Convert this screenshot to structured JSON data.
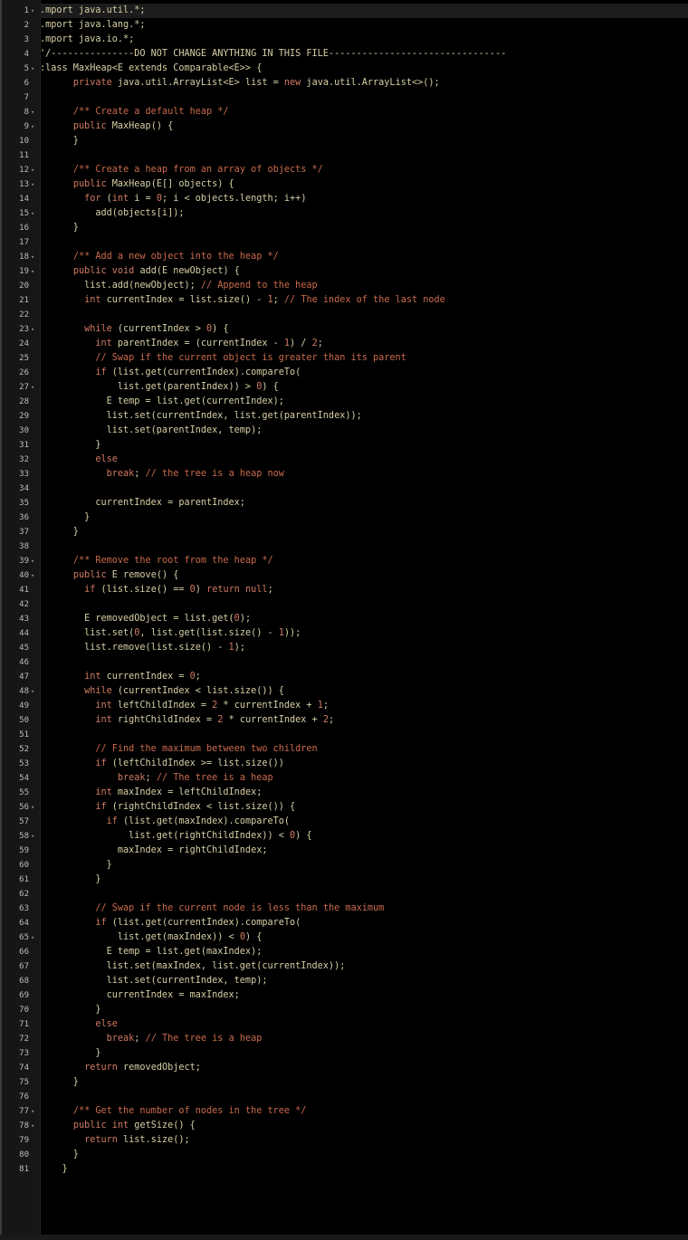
{
  "editor": {
    "language": "java",
    "colors": {
      "background": "#000000",
      "gutter": "#161616",
      "line_number": "#bdbdbd",
      "keyword": "#d07a62",
      "comment": "#c96a4c",
      "text": "#d6cfa6"
    },
    "fold_icon": "chevron-down-icon",
    "active_line": 1,
    "lines": [
      {
        "n": "1",
        "fold": true,
        "text": ".mport java.util.*;"
      },
      {
        "n": "2",
        "fold": false,
        "text": ".mport java.lang.*;"
      },
      {
        "n": "3",
        "fold": false,
        "text": ".mport java.io.*;"
      },
      {
        "n": "4",
        "fold": false,
        "text": "'/---------------DO NOT CHANGE ANYTHING IN THIS FILE--------------------------------"
      },
      {
        "n": "5",
        "fold": true,
        "text": ":lass MaxHeap<E extends Comparable<E>> {"
      },
      {
        "n": "6",
        "fold": false,
        "text": "      private java.util.ArrayList<E> list = new java.util.ArrayList<>();"
      },
      {
        "n": "7",
        "fold": false,
        "text": ""
      },
      {
        "n": "8",
        "fold": true,
        "text": "      /** Create a default heap */"
      },
      {
        "n": "9",
        "fold": true,
        "text": "      public MaxHeap() {"
      },
      {
        "n": "10",
        "fold": false,
        "text": "      }"
      },
      {
        "n": "11",
        "fold": false,
        "text": ""
      },
      {
        "n": "12",
        "fold": true,
        "text": "      /** Create a heap from an array of objects */"
      },
      {
        "n": "13",
        "fold": true,
        "text": "      public MaxHeap(E[] objects) {"
      },
      {
        "n": "14",
        "fold": false,
        "text": "        for (int i = 0; i < objects.length; i++)"
      },
      {
        "n": "15",
        "fold": true,
        "text": "          add(objects[i]);"
      },
      {
        "n": "16",
        "fold": false,
        "text": "      }"
      },
      {
        "n": "17",
        "fold": false,
        "text": ""
      },
      {
        "n": "18",
        "fold": true,
        "text": "      /** Add a new object into the heap */"
      },
      {
        "n": "19",
        "fold": true,
        "text": "      public void add(E newObject) {"
      },
      {
        "n": "20",
        "fold": false,
        "text": "        list.add(newObject); // Append to the heap"
      },
      {
        "n": "21",
        "fold": false,
        "text": "        int currentIndex = list.size() - 1; // The index of the last node"
      },
      {
        "n": "22",
        "fold": false,
        "text": ""
      },
      {
        "n": "23",
        "fold": true,
        "text": "        while (currentIndex > 0) {"
      },
      {
        "n": "24",
        "fold": false,
        "text": "          int parentIndex = (currentIndex - 1) / 2;"
      },
      {
        "n": "25",
        "fold": false,
        "text": "          // Swap if the current object is greater than its parent"
      },
      {
        "n": "26",
        "fold": false,
        "text": "          if (list.get(currentIndex).compareTo("
      },
      {
        "n": "27",
        "fold": true,
        "text": "              list.get(parentIndex)) > 0) {"
      },
      {
        "n": "28",
        "fold": false,
        "text": "            E temp = list.get(currentIndex);"
      },
      {
        "n": "29",
        "fold": false,
        "text": "            list.set(currentIndex, list.get(parentIndex));"
      },
      {
        "n": "30",
        "fold": false,
        "text": "            list.set(parentIndex, temp);"
      },
      {
        "n": "31",
        "fold": false,
        "text": "          }"
      },
      {
        "n": "32",
        "fold": false,
        "text": "          else"
      },
      {
        "n": "33",
        "fold": false,
        "text": "            break; // the tree is a heap now"
      },
      {
        "n": "34",
        "fold": false,
        "text": ""
      },
      {
        "n": "35",
        "fold": false,
        "text": "          currentIndex = parentIndex;"
      },
      {
        "n": "36",
        "fold": false,
        "text": "        }"
      },
      {
        "n": "37",
        "fold": false,
        "text": "      }"
      },
      {
        "n": "38",
        "fold": false,
        "text": ""
      },
      {
        "n": "39",
        "fold": true,
        "text": "      /** Remove the root from the heap */"
      },
      {
        "n": "40",
        "fold": true,
        "text": "      public E remove() {"
      },
      {
        "n": "41",
        "fold": false,
        "text": "        if (list.size() == 0) return null;"
      },
      {
        "n": "42",
        "fold": false,
        "text": ""
      },
      {
        "n": "43",
        "fold": false,
        "text": "        E removedObject = list.get(0);"
      },
      {
        "n": "44",
        "fold": false,
        "text": "        list.set(0, list.get(list.size() - 1));"
      },
      {
        "n": "45",
        "fold": false,
        "text": "        list.remove(list.size() - 1);"
      },
      {
        "n": "46",
        "fold": false,
        "text": ""
      },
      {
        "n": "47",
        "fold": false,
        "text": "        int currentIndex = 0;"
      },
      {
        "n": "48",
        "fold": true,
        "text": "        while (currentIndex < list.size()) {"
      },
      {
        "n": "49",
        "fold": false,
        "text": "          int leftChildIndex = 2 * currentIndex + 1;"
      },
      {
        "n": "50",
        "fold": false,
        "text": "          int rightChildIndex = 2 * currentIndex + 2;"
      },
      {
        "n": "51",
        "fold": false,
        "text": ""
      },
      {
        "n": "52",
        "fold": false,
        "text": "          // Find the maximum between two children"
      },
      {
        "n": "53",
        "fold": false,
        "text": "          if (leftChildIndex >= list.size())"
      },
      {
        "n": "54",
        "fold": false,
        "text": "              break; // The tree is a heap"
      },
      {
        "n": "55",
        "fold": false,
        "text": "          int maxIndex = leftChildIndex;"
      },
      {
        "n": "56",
        "fold": true,
        "text": "          if (rightChildIndex < list.size()) {"
      },
      {
        "n": "57",
        "fold": false,
        "text": "            if (list.get(maxIndex).compareTo("
      },
      {
        "n": "58",
        "fold": true,
        "text": "                list.get(rightChildIndex)) < 0) {"
      },
      {
        "n": "59",
        "fold": false,
        "text": "              maxIndex = rightChildIndex;"
      },
      {
        "n": "60",
        "fold": false,
        "text": "            }"
      },
      {
        "n": "61",
        "fold": false,
        "text": "          }"
      },
      {
        "n": "62",
        "fold": false,
        "text": ""
      },
      {
        "n": "63",
        "fold": false,
        "text": "          // Swap if the current node is less than the maximum"
      },
      {
        "n": "64",
        "fold": false,
        "text": "          if (list.get(currentIndex).compareTo("
      },
      {
        "n": "65",
        "fold": true,
        "text": "              list.get(maxIndex)) < 0) {"
      },
      {
        "n": "66",
        "fold": false,
        "text": "            E temp = list.get(maxIndex);"
      },
      {
        "n": "67",
        "fold": false,
        "text": "            list.set(maxIndex, list.get(currentIndex));"
      },
      {
        "n": "68",
        "fold": false,
        "text": "            list.set(currentIndex, temp);"
      },
      {
        "n": "69",
        "fold": false,
        "text": "            currentIndex = maxIndex;"
      },
      {
        "n": "70",
        "fold": false,
        "text": "          }"
      },
      {
        "n": "71",
        "fold": false,
        "text": "          else"
      },
      {
        "n": "72",
        "fold": false,
        "text": "            break; // The tree is a heap"
      },
      {
        "n": "73",
        "fold": false,
        "text": "          }"
      },
      {
        "n": "74",
        "fold": false,
        "text": "        return removedObject;"
      },
      {
        "n": "75",
        "fold": false,
        "text": "      }"
      },
      {
        "n": "76",
        "fold": false,
        "text": ""
      },
      {
        "n": "77",
        "fold": true,
        "text": "      /** Get the number of nodes in the tree */"
      },
      {
        "n": "78",
        "fold": true,
        "text": "      public int getSize() {"
      },
      {
        "n": "79",
        "fold": false,
        "text": "        return list.size();"
      },
      {
        "n": "80",
        "fold": false,
        "text": "      }"
      },
      {
        "n": "81",
        "fold": false,
        "text": "    }"
      }
    ]
  }
}
